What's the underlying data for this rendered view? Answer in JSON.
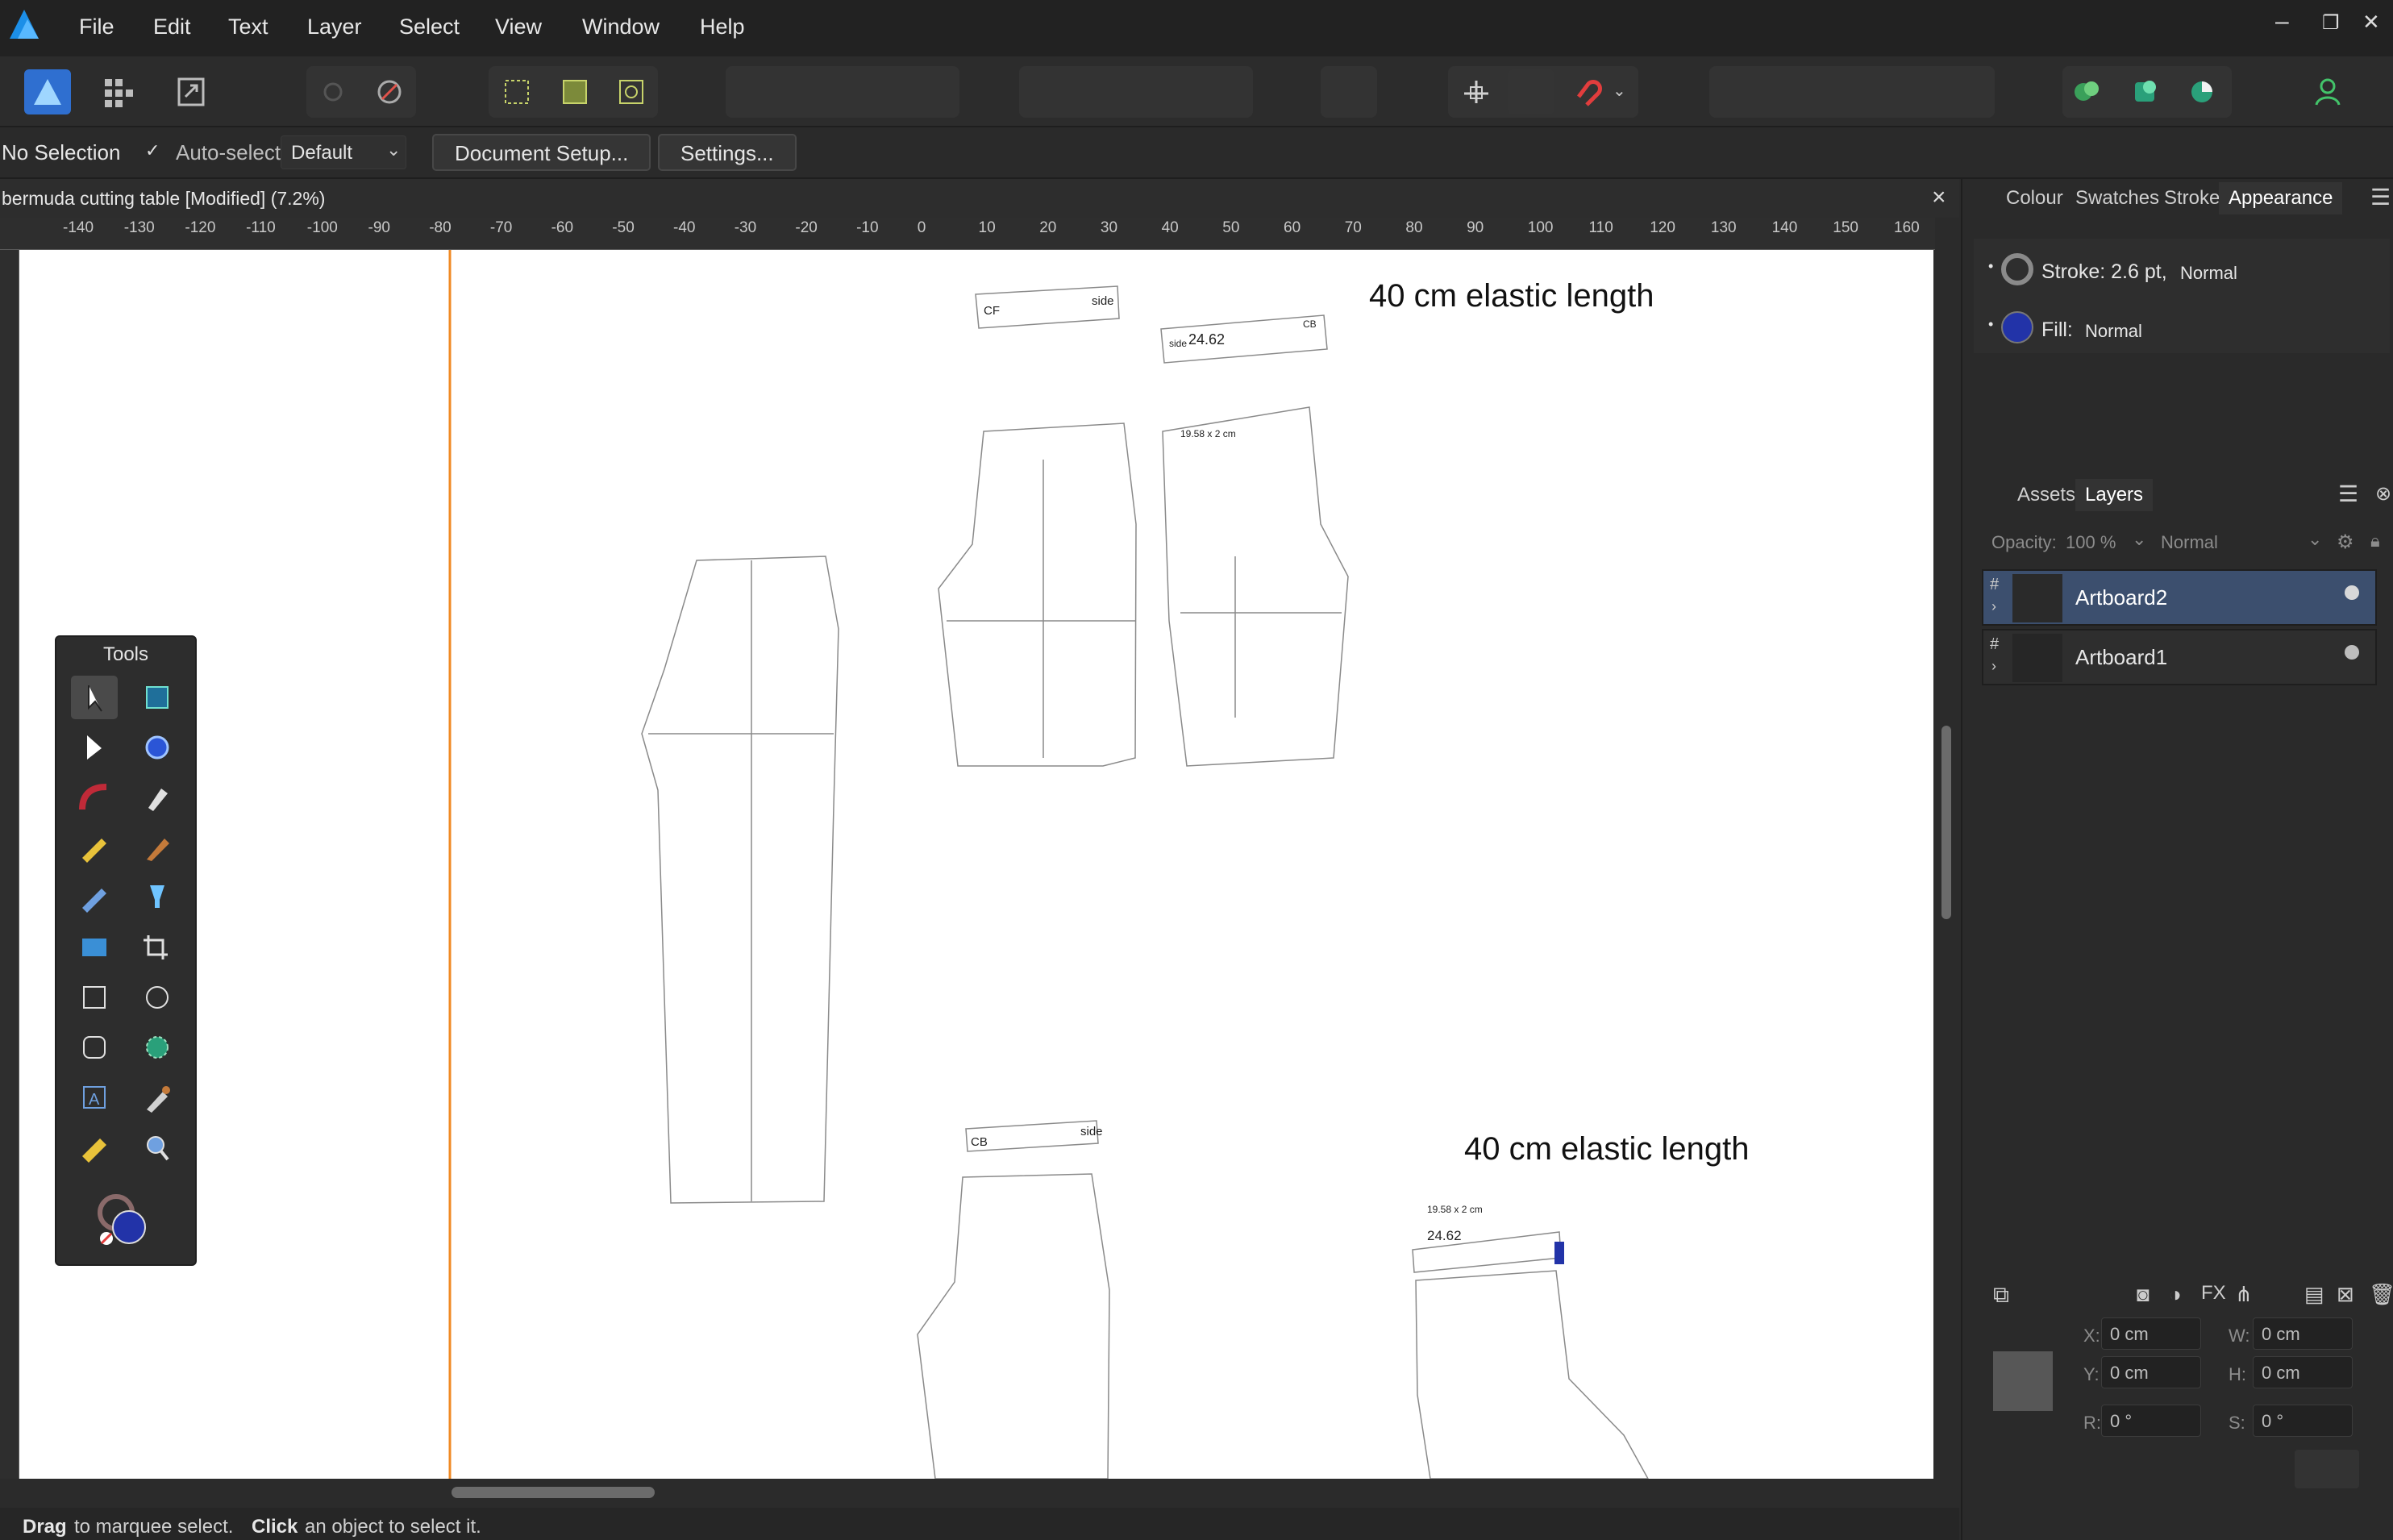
{
  "menu": [
    "File",
    "Edit",
    "Text",
    "Layer",
    "Select",
    "View",
    "Window",
    "Help"
  ],
  "window_controls": {
    "minimize": "–",
    "restore": "❐",
    "close": "✕"
  },
  "context": {
    "selection": "No Selection",
    "auto_select_label": "Auto-select:",
    "auto_select_value": "Default",
    "doc_setup": "Document Setup...",
    "settings": "Settings..."
  },
  "document": {
    "tab_title": "bermuda cutting table [Modified] (7.2%)",
    "close": "×"
  },
  "ruler_ticks": [
    "-140",
    "-130",
    "-120",
    "-110",
    "-100",
    "-90",
    "-80",
    "-70",
    "-60",
    "-50",
    "-40",
    "-30",
    "-20",
    "-10",
    "0",
    "10",
    "20",
    "30",
    "40",
    "50",
    "60",
    "70",
    "80",
    "90",
    "100",
    "110",
    "120",
    "130",
    "140",
    "150",
    "160"
  ],
  "canvas_text": {
    "elastic1": "40 cm elastic length",
    "elastic2": "40 cm elastic length",
    "wb1_left": "CF",
    "wb1_right": "side",
    "wb2_left": "side",
    "wb2_mid": "24.62",
    "wb2_right": "CB",
    "back_dim": "19.58 x 2 cm",
    "wb3_left": "CB",
    "wb3_right": "side",
    "wb4_dim": "19.58 x 2 cm",
    "wb4_num": "24.62"
  },
  "tools_panel": {
    "title": "Tools"
  },
  "panel_tabs_top": [
    "Colour",
    "Swatches",
    "Stroke",
    "Appearance"
  ],
  "appearance": {
    "stroke_label": "Stroke: 2.6 pt,",
    "stroke_mode": "Normal",
    "fill_label": "Fill:",
    "fill_mode": "Normal"
  },
  "panel_tabs_mid": [
    "Assets",
    "Layers"
  ],
  "layers": {
    "opacity_label": "Opacity:",
    "opacity_value": "100 %",
    "blend": "Normal",
    "items": [
      "Artboard2",
      "Artboard1"
    ]
  },
  "transform": {
    "x_label": "X:",
    "x_value": "0 cm",
    "y_label": "Y:",
    "y_value": "0 cm",
    "w_label": "W:",
    "w_value": "0 cm",
    "h_label": "H:",
    "h_value": "0 cm",
    "r_label": "R:",
    "r_value": "0 °",
    "s_label": "S:",
    "s_value": "0 °"
  },
  "status": {
    "drag": "Drag",
    "drag_text": "to marquee select.",
    "click": "Click",
    "click_text": "an object to select it."
  },
  "colors": {
    "accent": "#2f5dbf",
    "guide": "#f08a24",
    "fill": "#2233a8",
    "selected_layer": "#3c4f6e"
  }
}
